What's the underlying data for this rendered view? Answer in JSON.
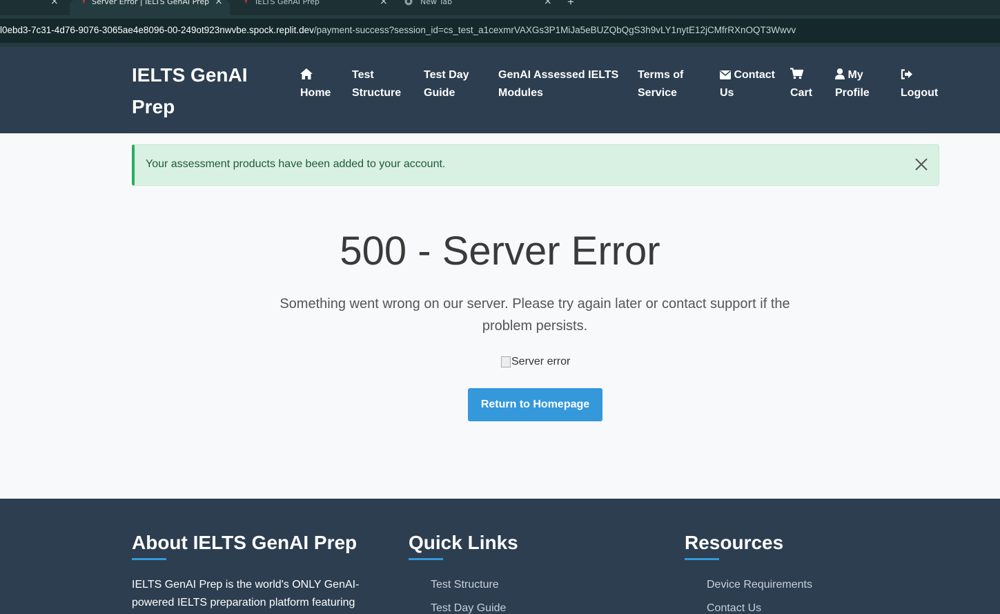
{
  "browser": {
    "tabs": [
      {
        "title": "",
        "active": false
      },
      {
        "title": "Server Error | IELTS GenAI Prep",
        "active": true
      },
      {
        "title": "IELTS GenAI Prep",
        "active": false
      },
      {
        "title": "New Tab",
        "active": false
      }
    ],
    "url_host": "l0ebd3-7c31-4d76-9076-3065ae4e8096-00-249ot923nwvbe.spock.replit.dev",
    "url_path": "/payment-success?session_id=cs_test_a1cexmrVAXGs3P1MiJa5eBUZQbQgS3h9vLY1nytE12jCMfrRXnOQT3Wwvv"
  },
  "navbar": {
    "brand": "IELTS GenAI Prep",
    "items": [
      {
        "label": "Home",
        "icon": "home-icon"
      },
      {
        "label": "Test Structure"
      },
      {
        "label": "Test Day Guide"
      },
      {
        "label": "GenAI Assessed IELTS Modules"
      },
      {
        "label": "Terms of Service"
      },
      {
        "label": "Contact Us",
        "icon": "envelope-icon"
      },
      {
        "label": "Cart",
        "icon": "cart-icon"
      },
      {
        "label": "My Profile",
        "icon": "user-icon"
      },
      {
        "label": "Logout",
        "icon": "logout-icon"
      }
    ]
  },
  "alert": {
    "message": "Your assessment products have been added to your account.",
    "color": "#27ae60"
  },
  "error": {
    "title": "500 - Server Error",
    "message": "Something went wrong on our server. Please try again later or contact support if the problem persists.",
    "image_alt": "Server error",
    "button_label": "Return to Homepage"
  },
  "footer": {
    "about_heading": "About IELTS GenAI Prep",
    "about_text": "IELTS GenAI Prep is the world's ONLY GenAI-powered IELTS preparation platform featuring",
    "quick_links_heading": "Quick Links",
    "quick_links": [
      "Test Structure",
      "Test Day Guide"
    ],
    "resources_heading": "Resources",
    "resources": [
      "Device Requirements",
      "Contact Us"
    ]
  },
  "colors": {
    "navbar_bg": "#2c3e50",
    "accent": "#3498db",
    "success": "#27ae60"
  }
}
